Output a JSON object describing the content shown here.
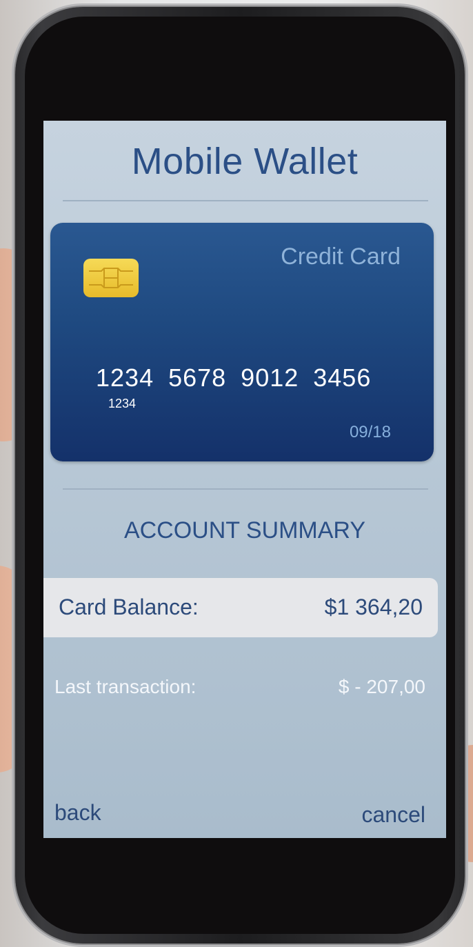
{
  "app": {
    "title": "Mobile Wallet"
  },
  "card": {
    "type_label": "Credit Card",
    "number": "1234 5678 9012 3456",
    "sub_number": "1234",
    "expiry": "09/18",
    "chip_icon": "card-chip-icon"
  },
  "summary": {
    "title": "ACCOUNT SUMMARY",
    "balance_label": "Card Balance:",
    "balance_value": "$1 364,20",
    "last_tx_label": "Last transaction:",
    "last_tx_value": "$ - 207,00"
  },
  "nav": {
    "back_label": "back",
    "cancel_label": "cancel"
  },
  "colors": {
    "accent": "#2b4f86",
    "card_top": "#2a5891",
    "card_bottom": "#14316a",
    "screen_bg": "#b8c8d6"
  }
}
